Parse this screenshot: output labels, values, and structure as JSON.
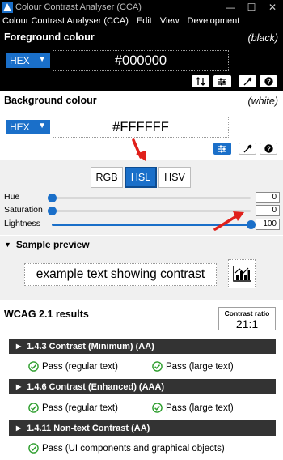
{
  "window": {
    "title": "Colour Contrast Analyser (CCA)",
    "controls": {
      "minimize": "—",
      "maximize": "☐",
      "close": "✕"
    }
  },
  "menu": [
    "Colour Contrast Analyser (CCA)",
    "Edit",
    "View",
    "Development"
  ],
  "foreground": {
    "label": "Foreground colour",
    "name": "(black)",
    "format": "HEX",
    "value": "#000000",
    "tools": [
      "swap-icon",
      "sliders-icon",
      "eyedropper-icon",
      "help-icon"
    ]
  },
  "background": {
    "label": "Background colour",
    "name": "(white)",
    "format": "HEX",
    "value": "#FFFFFF",
    "tools": [
      "sliders-icon",
      "eyedropper-icon",
      "help-icon"
    ]
  },
  "color_model_tabs": {
    "items": [
      "RGB",
      "HSL",
      "HSV"
    ],
    "active": "HSL"
  },
  "sliders": [
    {
      "label": "Hue",
      "value": "0",
      "fraction": 0.0
    },
    {
      "label": "Saturation",
      "value": "0",
      "fraction": 0.0
    },
    {
      "label": "Lightness",
      "value": "100",
      "fraction": 1.0
    }
  ],
  "sample": {
    "heading": "Sample preview",
    "text": "example text showing contrast"
  },
  "results": {
    "heading": "WCAG 2.1 results",
    "ratio_label": "Contrast ratio",
    "ratio": "21:1",
    "criteria": [
      {
        "title": "1.4.3 Contrast (Minimum) (AA)",
        "checks": [
          "Pass (regular text)",
          "Pass (large text)"
        ]
      },
      {
        "title": "1.4.6 Contrast (Enhanced) (AAA)",
        "checks": [
          "Pass (regular text)",
          "Pass (large text)"
        ]
      },
      {
        "title": "1.4.11 Non-text Contrast (AA)",
        "checks": [
          "Pass (UI components and graphical objects)"
        ]
      }
    ]
  },
  "colors": {
    "accent": "#1a6fc9",
    "pass_green": "#2e9e2e",
    "annotation_red": "#e0201b",
    "criterion_bar": "#333333"
  }
}
